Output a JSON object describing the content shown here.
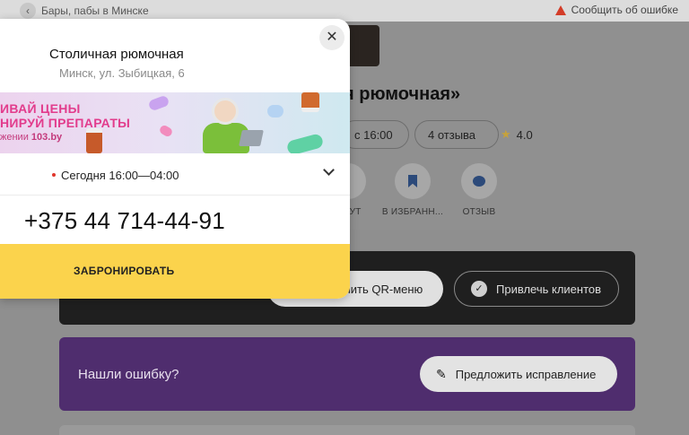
{
  "topbar": {
    "back_icon": "chevron-left-icon",
    "breadcrumb": "Бары, пабы в Минске",
    "report_label": "Сообщить об ошибке",
    "report_icon": "warning-icon"
  },
  "place": {
    "title_partial": "я рюмочная»",
    "hours_chip": "с 16:00",
    "reviews_chip": "4 отзыва",
    "rating": "4.0"
  },
  "actions": [
    {
      "label": "ШРУТ",
      "icon": "route-icon"
    },
    {
      "label": "В ИЗБРАНН...",
      "icon": "bookmark-icon"
    },
    {
      "label": "ОТЗЫВ",
      "icon": "comment-icon"
    }
  ],
  "promo_card": {
    "qr_label": "чить QR-меню",
    "clients_label": "Привлечь клиентов"
  },
  "error_card": {
    "text": "Нашли ошибку?",
    "suggest_label": "Предложить исправление"
  },
  "modal": {
    "title": "Столичная рюмочная",
    "address": "Минск, ул. Зыбицкая, 6",
    "banner": {
      "line1": "ИВАЙ ЦЕНЫ",
      "line2": "НИРУЙ ПРЕПАРАТЫ",
      "line3_prefix": "жении ",
      "line3_brand": "103.by"
    },
    "hours": "Сегодня 16:00—04:00",
    "phone": "+375 44 714-44-91",
    "book_label": "ЗАБРОНИРОВАТЬ",
    "close_symbol": "✕"
  },
  "colors": {
    "accent_yellow": "#fbd34c",
    "purple_card": "#4f2d6e",
    "status_dot": "#e0362c",
    "banner_text": "#e23c8c"
  }
}
